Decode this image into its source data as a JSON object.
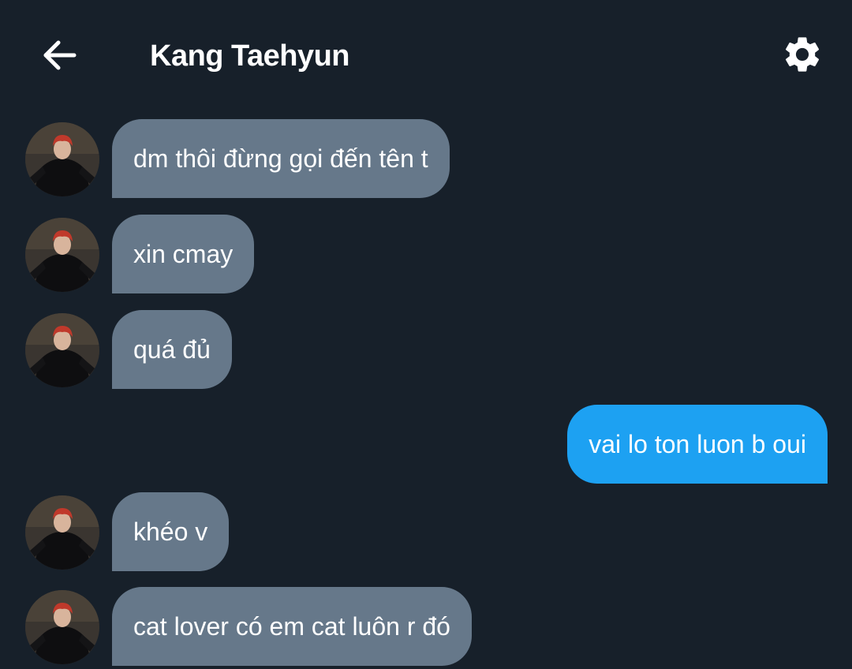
{
  "header": {
    "title": "Kang Taehyun",
    "back_icon": "arrow-left-icon",
    "settings_icon": "gear-icon"
  },
  "colors": {
    "background": "#17202a",
    "incoming_bubble": "#66788a",
    "outgoing_bubble": "#1da1f2",
    "text": "#ffffff"
  },
  "messages": [
    {
      "direction": "incoming",
      "text": "dm thôi đừng gọi đến tên t"
    },
    {
      "direction": "incoming",
      "text": "xin cmay"
    },
    {
      "direction": "incoming",
      "text": "quá đủ"
    },
    {
      "direction": "outgoing",
      "text": "vai lo ton luon b oui"
    },
    {
      "direction": "incoming",
      "text": "khéo v"
    },
    {
      "direction": "incoming",
      "text": "cat lover có em cat luôn r đó"
    }
  ]
}
